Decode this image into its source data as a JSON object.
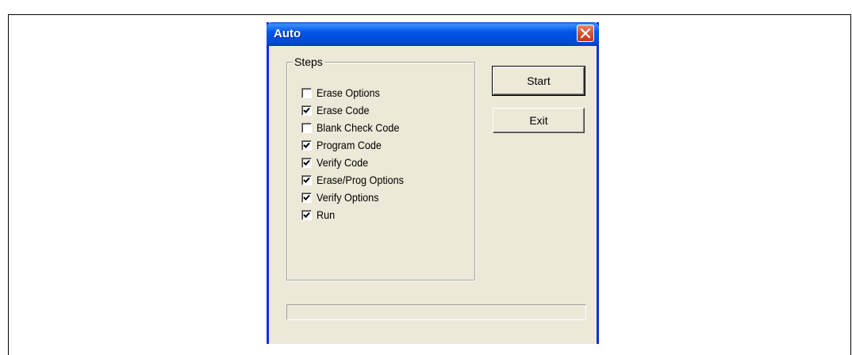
{
  "window": {
    "title": "Auto"
  },
  "steps_group": {
    "label": "Steps",
    "items": [
      {
        "label": "Erase Options",
        "checked": false
      },
      {
        "label": "Erase Code",
        "checked": true
      },
      {
        "label": "Blank Check Code",
        "checked": false
      },
      {
        "label": "Program Code",
        "checked": true
      },
      {
        "label": "Verify Code",
        "checked": true
      },
      {
        "label": "Erase/Prog Options",
        "checked": true
      },
      {
        "label": "Verify Options",
        "checked": true
      },
      {
        "label": "Run",
        "checked": true
      }
    ]
  },
  "buttons": {
    "start_label": "Start",
    "exit_label": "Exit"
  },
  "progress": {
    "value": 0
  },
  "icons": {
    "close": "close-icon",
    "check": "check-icon"
  },
  "colors": {
    "titlebar": "#0257e8",
    "dialog_bg": "#ece9d8",
    "close_button": "#d24a2c"
  }
}
